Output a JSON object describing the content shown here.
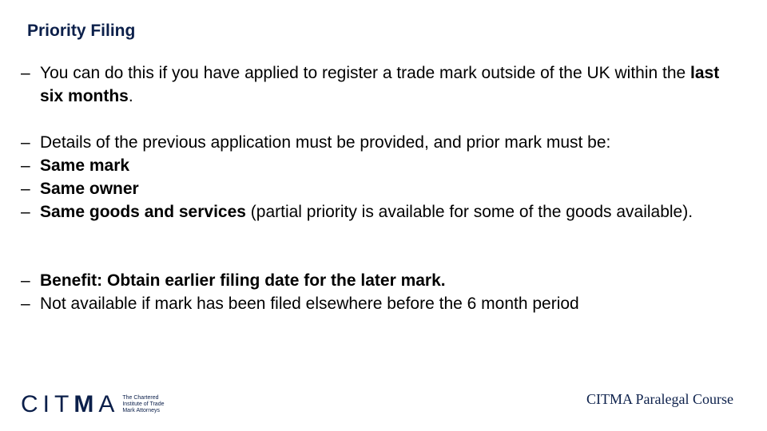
{
  "slide": {
    "title": "Priority Filing",
    "bullet_dash": "–",
    "group1": [
      {
        "text_before": "You can do this if you have applied to register a trade mark outside of the UK within the ",
        "bold": "last six months",
        "text_after": "."
      }
    ],
    "group2": [
      {
        "text_before": "Details of the previous application must be provided, and prior mark must be:",
        "bold": "",
        "text_after": ""
      },
      {
        "text_before": "",
        "bold": "Same mark",
        "text_after": ""
      },
      {
        "text_before": "",
        "bold": "Same owner",
        "text_after": ""
      },
      {
        "text_before": "",
        "bold": "Same goods and services",
        "text_after": " (partial priority is available for some of the goods available)."
      }
    ],
    "group3": [
      {
        "text_before": "",
        "bold": "Benefit: Obtain earlier filing date for the later mark.",
        "text_after": ""
      },
      {
        "text_before": "Not available if mark has been filed elsewhere before the 6 month period",
        "bold": "",
        "text_after": ""
      }
    ]
  },
  "logo": {
    "wordmark_light": "CIT",
    "wordmark_bold": "M",
    "wordmark_end": "A",
    "subtitle_lines": [
      "The Chartered",
      "Institute of Trade",
      "Mark Attorneys"
    ]
  },
  "footer": {
    "course": "CITMA Paralegal Course"
  }
}
